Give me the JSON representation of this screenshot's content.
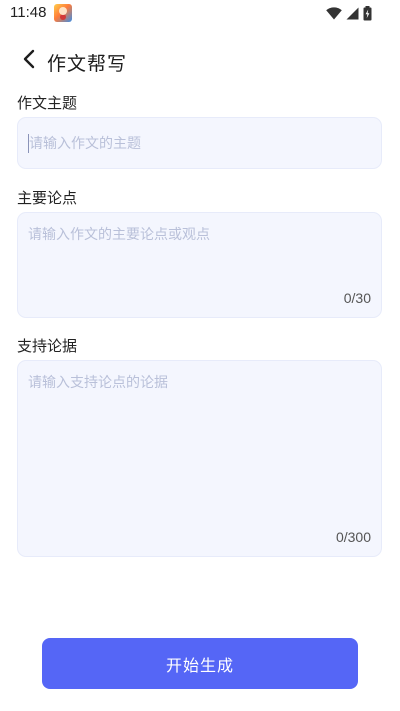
{
  "status_bar": {
    "time": "11:48",
    "app_notification_icon": "game-app-icon",
    "icons": [
      "wifi-icon",
      "signal-icon",
      "battery-icon"
    ]
  },
  "header": {
    "back_icon": "chevron-left-icon",
    "title": "作文帮写"
  },
  "form": {
    "topic": {
      "label": "作文主题",
      "placeholder": "请输入作文的主题",
      "value": ""
    },
    "main_points": {
      "label": "主要论点",
      "placeholder": "请输入作文的主要论点或观点",
      "value": "",
      "count": "0/30"
    },
    "evidence": {
      "label": "支持论据",
      "placeholder": "请输入支持论点的论据",
      "value": "",
      "count": "0/300"
    }
  },
  "actions": {
    "generate_label": "开始生成"
  },
  "colors": {
    "primary": "#5566f6",
    "field_background": "#f4f6fe",
    "placeholder": "#b9c0d9"
  }
}
